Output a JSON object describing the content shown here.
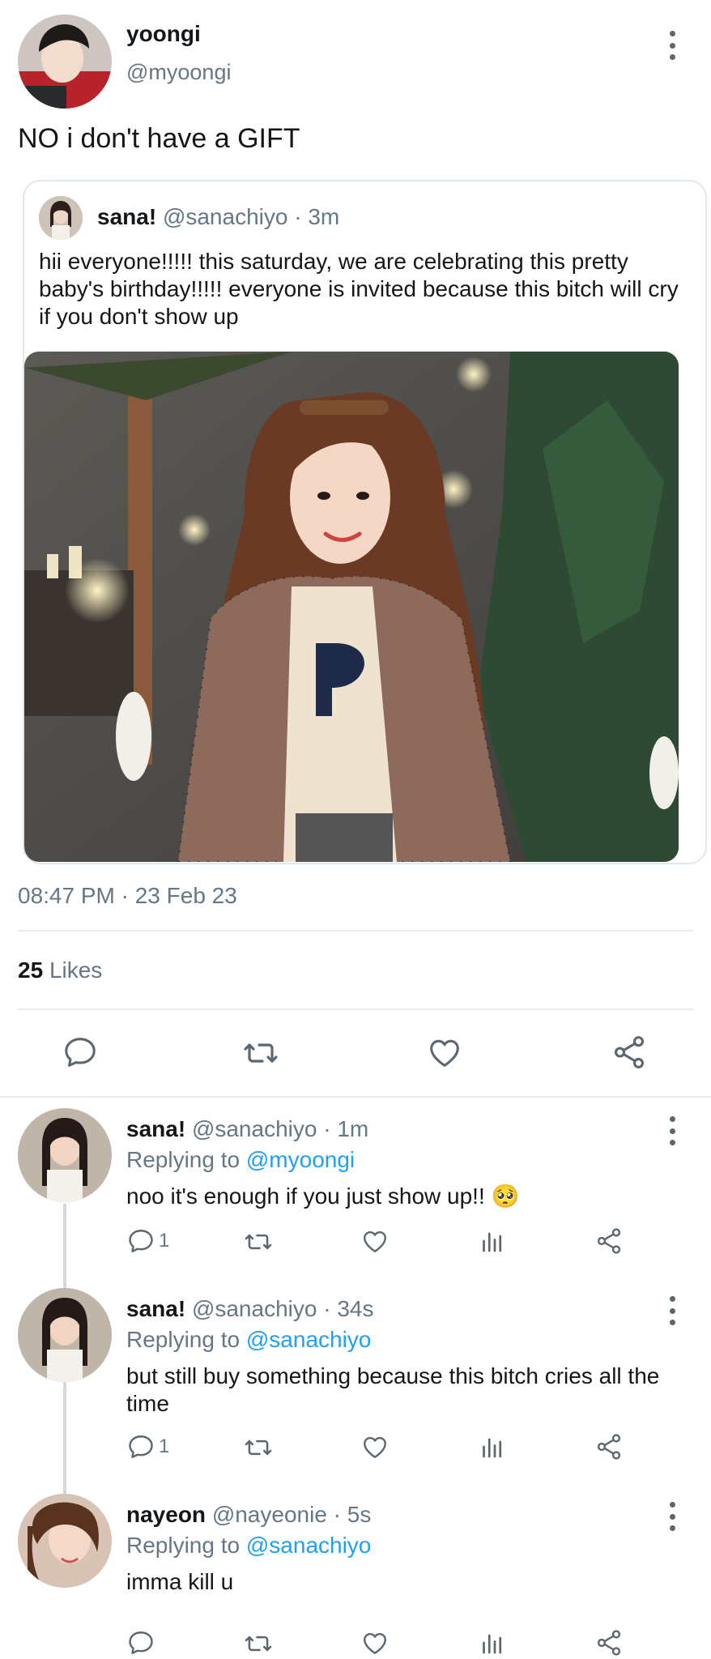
{
  "main_tweet": {
    "name": "yoongi",
    "handle": "@myoongi",
    "text": "NO i don't have a GIFT",
    "more_icon": "more-vertical-icon"
  },
  "quoted_tweet": {
    "name": "sana!",
    "handle": "@sanachiyo",
    "time": "· 3m",
    "text": "hii everyone!!!!! this saturday, we are celebrating this pretty baby's birthday!!!!! everyone is invited because this bitch will cry if you don't show up"
  },
  "tweet_footer": {
    "timestamp": "08:47 PM · 23 Feb 23",
    "likes_count": "25",
    "likes_label": "Likes"
  },
  "main_actions": {
    "icons": [
      "reply-icon",
      "retweet-icon",
      "like-icon",
      "share-icon"
    ]
  },
  "replies": [
    {
      "name": "sana!",
      "handle": "@sanachiyo",
      "time": "· 1m",
      "replying_label": "Replying to",
      "replying_to": "@myoongi",
      "text": "noo it's enough if you just show up!! 🥺",
      "reply_count": "1"
    },
    {
      "name": "sana!",
      "handle": "@sanachiyo",
      "time": "· 34s",
      "replying_label": "Replying to",
      "replying_to": "@sanachiyo",
      "text": "but still buy something because this bitch cries all the time",
      "reply_count": "1"
    },
    {
      "name": "nayeon",
      "handle": "@nayeonie",
      "time": "· 5s",
      "replying_label": "Replying to",
      "replying_to": "@sanachiyo",
      "text": "imma kill u",
      "reply_count": ""
    }
  ],
  "colors": {
    "text": "#14171a",
    "muted": "#657786",
    "link": "#1da1f2",
    "divider": "#e6ecf0"
  }
}
